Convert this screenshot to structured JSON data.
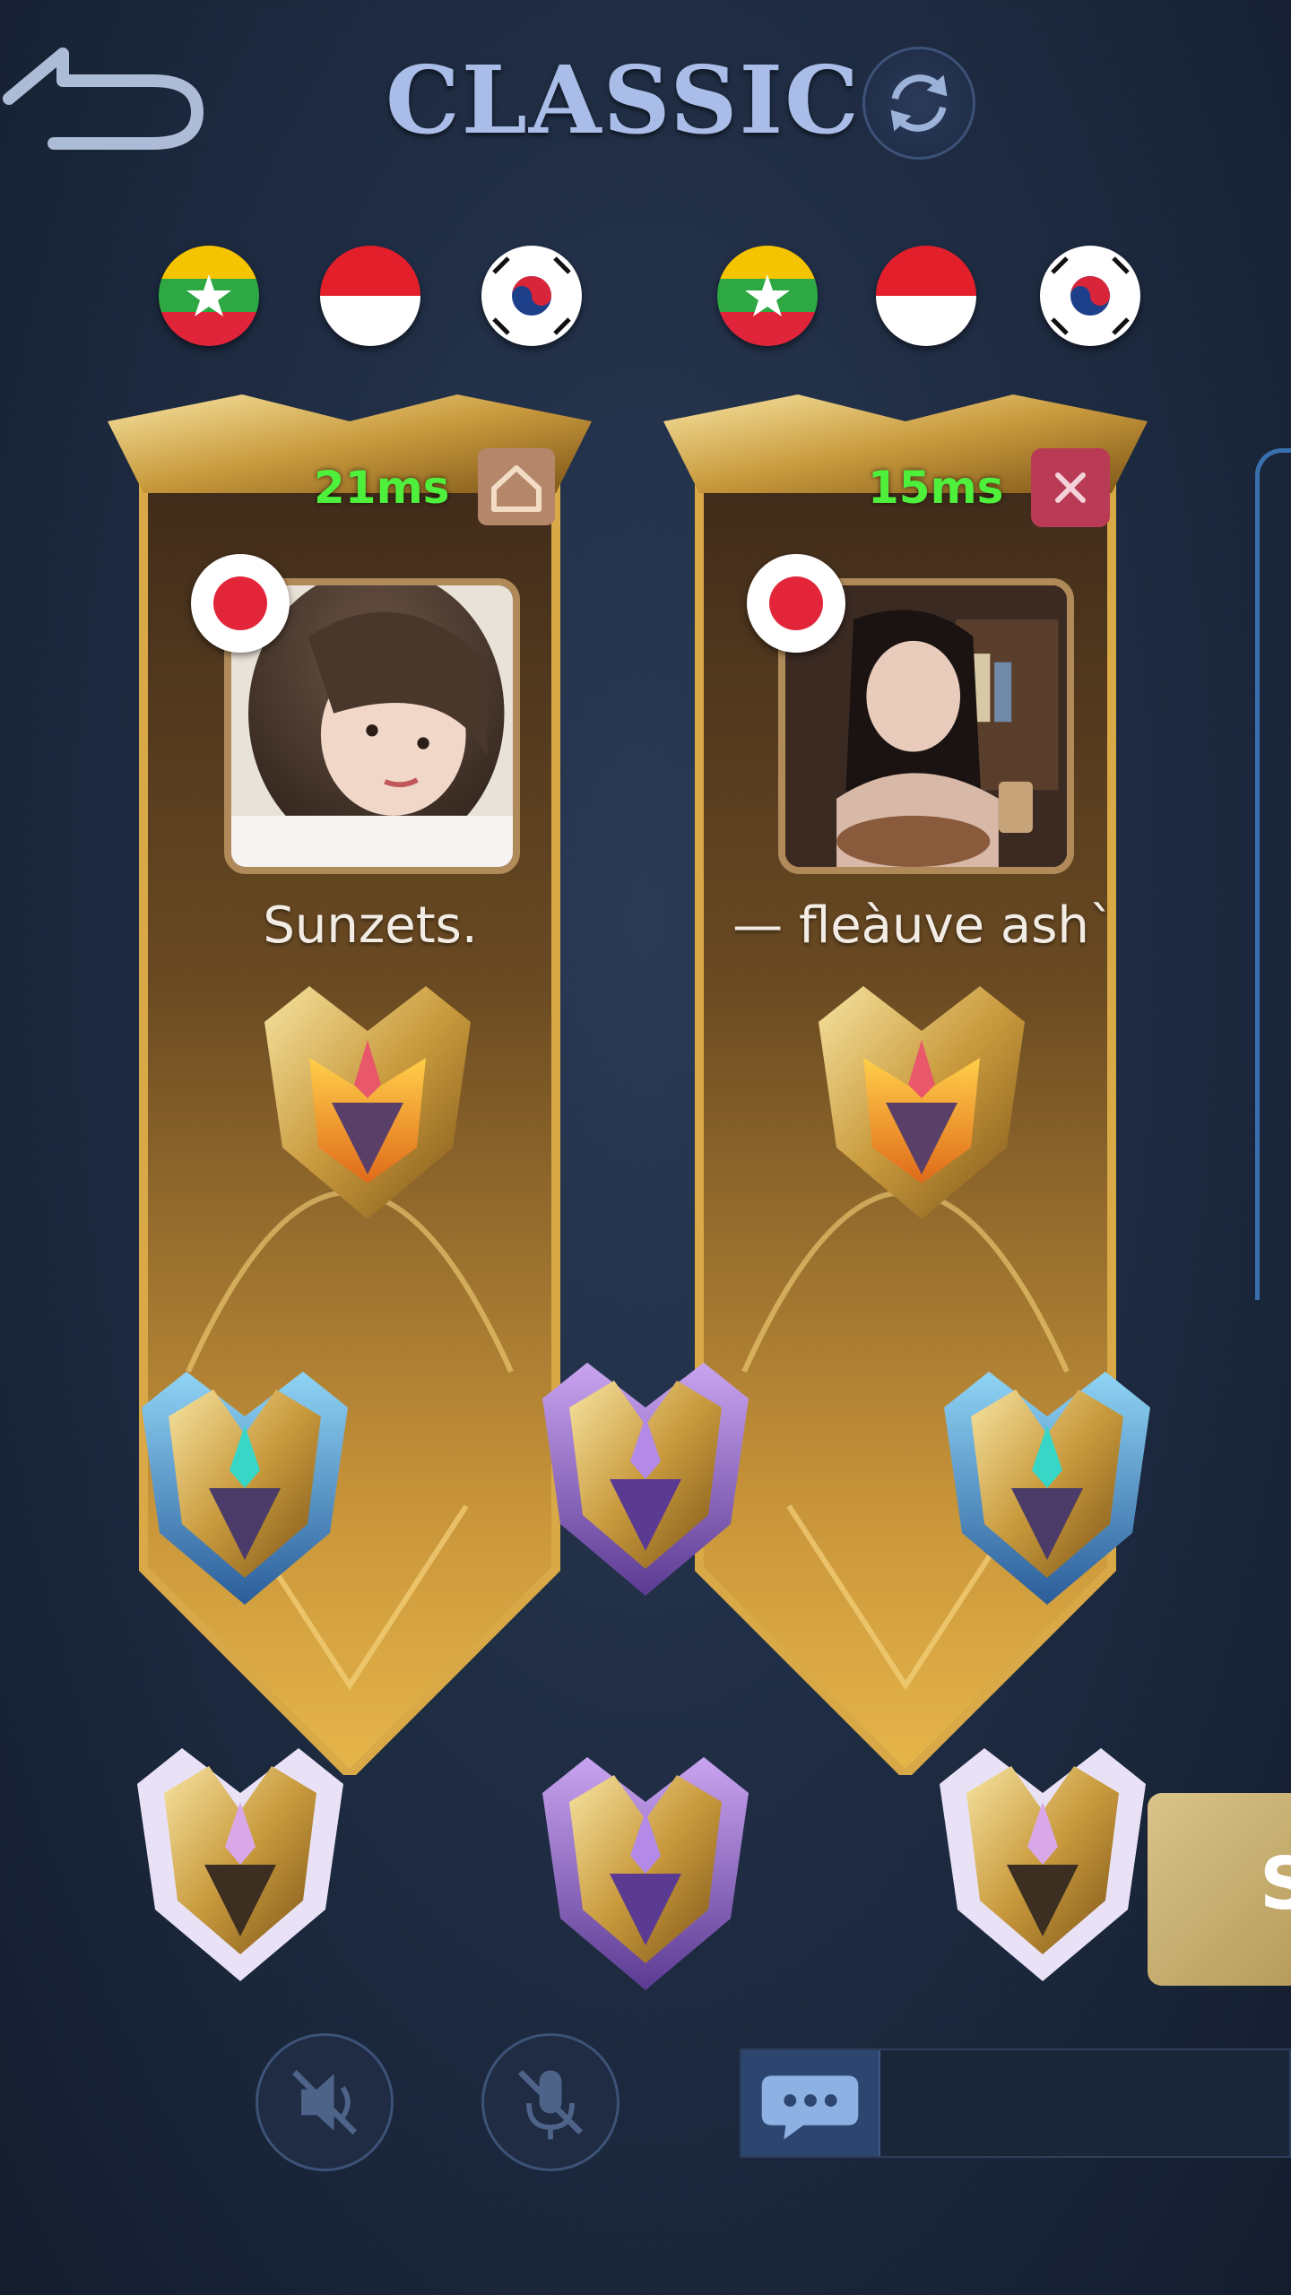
{
  "header": {
    "back_icon": "back-arrow-icon",
    "title": "CLASSIC",
    "refresh_icon": "refresh-icon"
  },
  "teams": {
    "left_flags": [
      "Myanmar",
      "Indonesia",
      "South Korea"
    ],
    "right_flags": [
      "Myanmar",
      "Indonesia",
      "South Korea"
    ]
  },
  "players": [
    {
      "ping": "21ms",
      "status_icon": "home-icon",
      "country_badge": "Japan",
      "name": "Sunzets.",
      "rank": "mythic-honor"
    },
    {
      "ping": "15ms",
      "status_icon": "close-icon",
      "country_badge": "Japan",
      "name": "— fleàuve ash`",
      "rank": "mythic-honor"
    }
  ],
  "rank_badges": {
    "row1": [
      "mythic-blue",
      "mythic-purple",
      "mythic-blue"
    ],
    "row2": [
      "mythic-glory",
      "mythic-purple",
      "mythic-glory"
    ]
  },
  "controls": {
    "speaker_icon": "speaker-muted-icon",
    "mic_icon": "mic-muted-icon",
    "chat_icon": "chat-icon"
  },
  "side_card_text": "S",
  "colors": {
    "ping": "#4ff03c",
    "title": "#a9bde8",
    "gold": "#c9a04a",
    "background": "#1d2a40"
  }
}
